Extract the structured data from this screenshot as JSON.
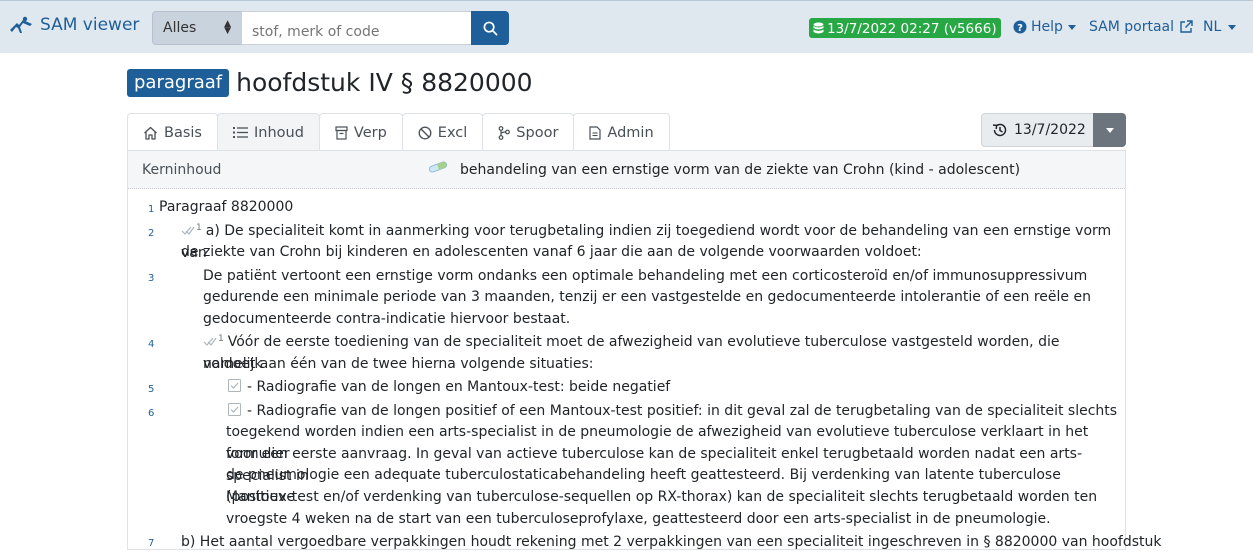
{
  "navbar": {
    "brand": "SAM viewer",
    "search_scope": "Alles",
    "search_placeholder": "stof, merk of code",
    "version": "13/7/2022 02:27 (v5666)",
    "help": "Help",
    "portal": "SAM portaal",
    "language": "NL"
  },
  "header": {
    "type_badge": "paragraaf",
    "title": "hoofdstuk IV § 8820000"
  },
  "tabs": [
    {
      "label": "Basis",
      "icon": "home-icon"
    },
    {
      "label": "Inhoud",
      "icon": "list-icon",
      "active": true
    },
    {
      "label": "Verp",
      "icon": "package-icon"
    },
    {
      "label": "Excl",
      "icon": "ban-icon"
    },
    {
      "label": "Spoor",
      "icon": "branch-icon"
    },
    {
      "label": "Admin",
      "icon": "document-icon"
    }
  ],
  "date_selector": {
    "value": "13/7/2022",
    "icon": "history-icon"
  },
  "kernel": {
    "label": "Kerninhoud",
    "text": "behandeling van een ernstige vorm van de ziekte van Crohn (kind - adolescent)"
  },
  "content": {
    "l1": {
      "num": "1",
      "text": "Paragraaf 8820000"
    },
    "l2": {
      "num": "2",
      "sup": "1",
      "line1": "a) De specialiteit komt in aanmerking voor terugbetaling indien zij toegediend wordt voor de behandeling van een ernstige vorm van",
      "line2": "de ziekte van Crohn bij kinderen en adolescenten vanaf 6 jaar die aan de volgende voorwaarden voldoet:"
    },
    "l3": {
      "num": "3",
      "line1": "De patiënt vertoont een ernstige vorm ondanks een optimale behandeling met een corticosteroïd en/of immunosuppressivum",
      "line2": "gedurende een minimale periode van 3 maanden, tenzij er een vastgestelde en gedocumenteerde intolerantie of een reële en",
      "line3": "gedocumenteerde contra-indicatie hiervoor bestaat."
    },
    "l4": {
      "num": "4",
      "sup": "1",
      "line1": "Vóór de eerste toediening van de specialiteit moet de afwezigheid van evolutieve tuberculose vastgesteld worden, die namelijk",
      "line2": "voldoet aan één van de twee hierna volgende situaties:"
    },
    "l5": {
      "num": "5",
      "text": "- Radiografie van de longen en Mantoux-test: beide negatief"
    },
    "l6": {
      "num": "6",
      "line1": "- Radiografie van de longen positief of een Mantoux-test positief: in dit geval zal de terugbetaling van de specialiteit slechts",
      "line2": "toegekend worden indien een arts-specialist in de pneumologie de afwezigheid van evolutieve tuberculose verklaart in het formulier",
      "line3": "voor een eerste aanvraag. In geval van actieve tuberculose kan de specialiteit enkel terugbetaald worden nadat een arts-specialist in",
      "line4": "de pneumologie een adequate tuberculostaticabehandeling heeft geattesteerd. Bij verdenking van latente tuberculose (positieve",
      "line5": "Mantoux-test en/of verdenking van tuberculose-sequellen op RX-thorax) kan de specialiteit slechts terugbetaald worden ten",
      "line6": "vroegste 4 weken na de start van een tuberculoseprofylaxe, geattesteerd door een arts-specialist in de pneumologie."
    },
    "l7": {
      "num": "7",
      "text": "b) Het aantal vergoedbare verpakkingen houdt rekening met 2 verpakkingen van een specialiteit ingeschreven in § 8820000 van hoofdstuk"
    }
  }
}
